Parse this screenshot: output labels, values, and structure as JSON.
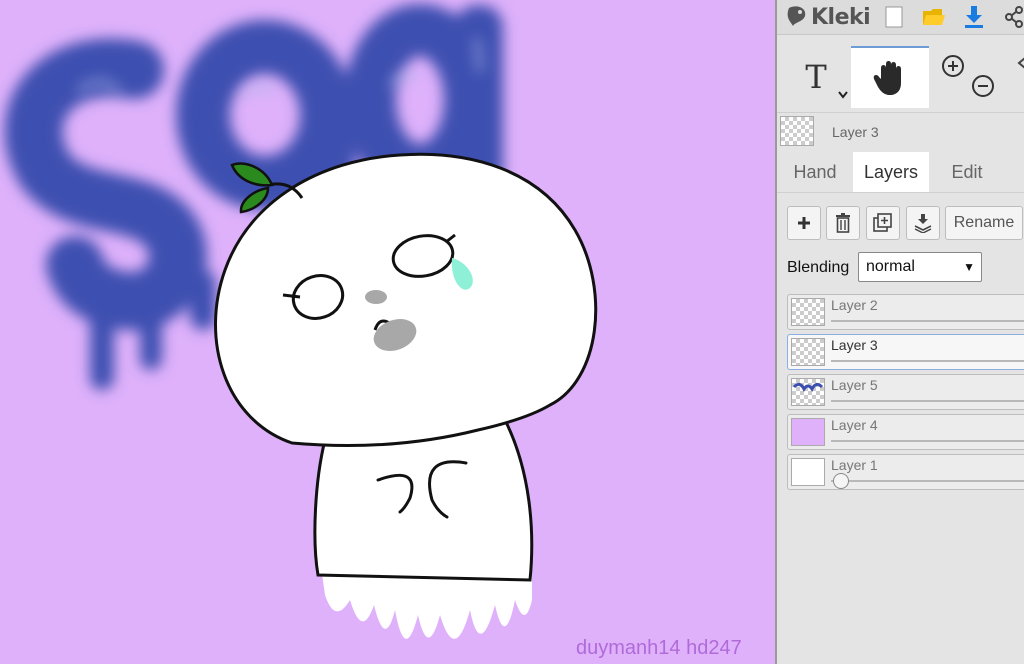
{
  "app": {
    "name": "Kleki"
  },
  "canvas": {
    "background_color": "#dfb1fb",
    "signature": "duymanh14 hd247"
  },
  "toolbar_icons": [
    "new-file-icon",
    "open-folder-icon",
    "download-icon",
    "share-icon"
  ],
  "tools": [
    {
      "name": "text-tool",
      "label": "T"
    },
    {
      "name": "hand-tool",
      "selected": true
    },
    {
      "name": "zoom-tool"
    }
  ],
  "current_layer": {
    "name": "Layer 3"
  },
  "tabs": [
    {
      "label": "Hand"
    },
    {
      "label": "Layers",
      "active": true
    },
    {
      "label": "Edit"
    }
  ],
  "layer_actions": {
    "rename_label": "Rename"
  },
  "blending": {
    "label": "Blending",
    "value": "normal"
  },
  "layers": [
    {
      "name": "Layer 2"
    },
    {
      "name": "Layer 3",
      "active": true
    },
    {
      "name": "Layer 5"
    },
    {
      "name": "Layer 4",
      "color": "#dfb1fb"
    },
    {
      "name": "Layer 1",
      "color": "#ffffff"
    }
  ],
  "colors": {
    "accent": "#6c9bd6",
    "signature": "#b06ad9",
    "sad_text": "#3c4fb0",
    "leaf": "#2b8a1e",
    "tear": "#8ff0d8"
  }
}
